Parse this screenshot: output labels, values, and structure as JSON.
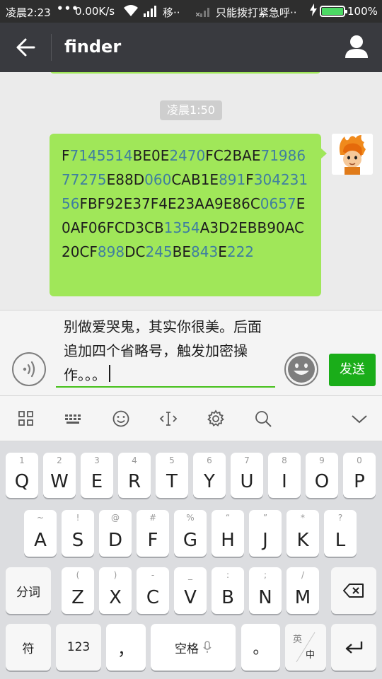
{
  "status_bar": {
    "time": "凌晨2:23",
    "dots": "•••",
    "speed": "0.00K/s",
    "carrier": "移··",
    "emergency": "只能拨打紧急呼··",
    "battery_percent": "100%",
    "battery_level": 1.0,
    "battery_color": "#4cd964"
  },
  "header": {
    "back_icon": "arrow-left-icon",
    "title": "finder",
    "profile_icon": "person-icon"
  },
  "chat": {
    "timestamp": "凌晨1:50",
    "message": {
      "text": "F7145514BE0E2470FC2BAE7198677275E88D060CAB1E891F30423156FBF92E37F4E23AA9E86C0657E0AF06FCD3CB1354A3D2EBB90AC20CF898DC245BE843E222",
      "bubble_color": "#a0e759",
      "number_color": "#3f7ea0"
    }
  },
  "input": {
    "voice_icon": "voice-wave-icon",
    "text": "别做爱哭鬼，其实你很美。后面追加四个省略号，触发加密操作。。。",
    "emoji_icon": "smiley-icon",
    "send_label": "发送",
    "send_color": "#1aad19"
  },
  "keyboard_toolbar": {
    "icons": [
      "grid-icon",
      "keyboard-icon",
      "smiley-icon",
      "cursor-icon",
      "gear-icon",
      "search-icon",
      "chevron-down-icon"
    ]
  },
  "keyboard": {
    "row1": [
      {
        "main": "Q",
        "sub": "1"
      },
      {
        "main": "W",
        "sub": "2"
      },
      {
        "main": "E",
        "sub": "3"
      },
      {
        "main": "R",
        "sub": "4"
      },
      {
        "main": "T",
        "sub": "5"
      },
      {
        "main": "Y",
        "sub": "6"
      },
      {
        "main": "U",
        "sub": "7"
      },
      {
        "main": "I",
        "sub": "8"
      },
      {
        "main": "O",
        "sub": "9"
      },
      {
        "main": "P",
        "sub": "0"
      }
    ],
    "row2": [
      {
        "main": "A",
        "sub": "~"
      },
      {
        "main": "S",
        "sub": "!"
      },
      {
        "main": "D",
        "sub": "@"
      },
      {
        "main": "F",
        "sub": "#"
      },
      {
        "main": "G",
        "sub": "%"
      },
      {
        "main": "H",
        "sub": "“"
      },
      {
        "main": "J",
        "sub": "”"
      },
      {
        "main": "K",
        "sub": "*"
      },
      {
        "main": "L",
        "sub": "?"
      }
    ],
    "row3": [
      {
        "main": "Z",
        "sub": "("
      },
      {
        "main": "X",
        "sub": ")"
      },
      {
        "main": "C",
        "sub": "-"
      },
      {
        "main": "V",
        "sub": "_"
      },
      {
        "main": "B",
        "sub": ":"
      },
      {
        "main": "N",
        "sub": ";"
      },
      {
        "main": "M",
        "sub": "/"
      }
    ],
    "segment_label": "分词",
    "backspace_icon": "backspace-icon",
    "symbol_label": "符",
    "num_label": "123",
    "comma_label": "，",
    "space_label": "空格",
    "mic_icon": "mic-icon",
    "period_label": "。",
    "lang_top": "英",
    "lang_bottom": "中",
    "enter_icon": "enter-icon"
  }
}
